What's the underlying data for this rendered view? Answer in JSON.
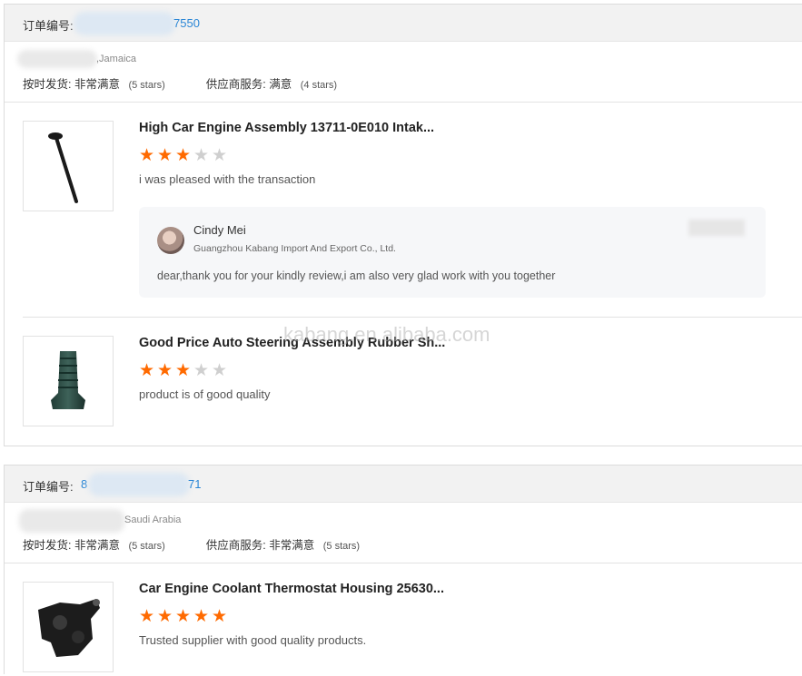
{
  "orders": [
    {
      "order_label": "订单编号:",
      "order_number_visible": "7550",
      "country": ",Jamaica",
      "ontime_label": "按时发货:",
      "ontime_value": "非常满意",
      "ontime_stars": "(5 stars)",
      "service_label": "供应商服务:",
      "service_value": "满意",
      "service_stars": "(4 stars)",
      "items": [
        {
          "title": "High Car Engine Assembly 13711-0E010 Intak...",
          "rating": 3,
          "comment": "i was pleased with the transaction",
          "reply": {
            "name": "Cindy Mei",
            "company": "Guangzhou Kabang Import And Export Co., Ltd.",
            "text": "dear,thank you for your kindly review,i am also very glad work with you together"
          }
        },
        {
          "title": "Good Price Auto Steering Assembly Rubber Sh...",
          "rating": 3,
          "comment": "product is of good quality"
        }
      ]
    },
    {
      "order_label": "订单编号:",
      "order_number_prefix": "8",
      "order_number_visible": "71",
      "country": "Saudi Arabia",
      "ontime_label": "按时发货:",
      "ontime_value": "非常满意",
      "ontime_stars": "(5 stars)",
      "service_label": "供应商服务:",
      "service_value": "非常满意",
      "service_stars": "(5 stars)",
      "items": [
        {
          "title": "Car Engine Coolant Thermostat Housing 25630...",
          "rating": 5,
          "comment": "Trusted supplier with good quality products."
        }
      ]
    }
  ],
  "watermark": "kabang.en.alibaba.com",
  "colors": {
    "star_on": "#ff6a00",
    "star_off": "#cfcfcf",
    "order_link": "#2a86d6"
  },
  "icons": {
    "star": "star-icon",
    "avatar": "avatar"
  }
}
